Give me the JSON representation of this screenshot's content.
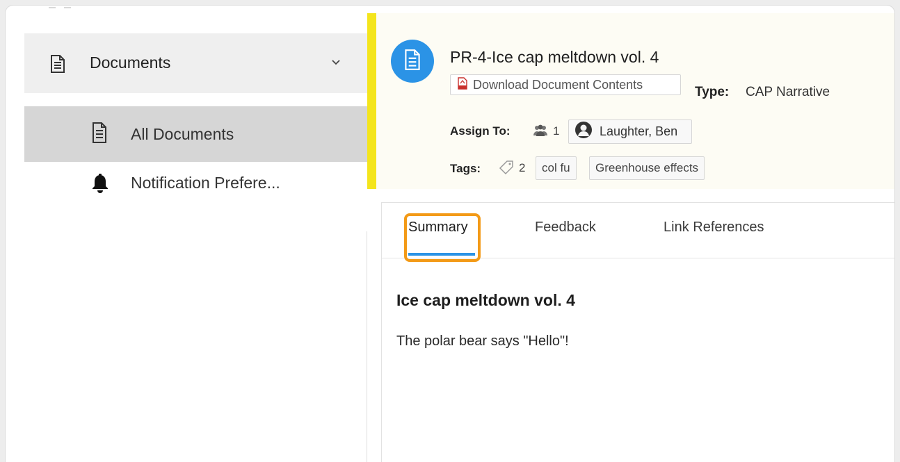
{
  "sidebar": {
    "group": {
      "label": "Documents",
      "icon": "document-icon",
      "expanded": true
    },
    "items": [
      {
        "label": "All Documents",
        "icon": "document-icon",
        "active": true
      },
      {
        "label": "Notification Prefere...",
        "icon": "bell-icon",
        "active": false
      }
    ]
  },
  "document": {
    "title": "PR-4-Ice cap meltdown vol. 4",
    "download_label": "Download Document Contents",
    "type_label": "Type:",
    "type_value": "CAP Narrative",
    "assign_label": "Assign To:",
    "assign_count": "1",
    "assignee": "Laughter, Ben",
    "tags_label": "Tags:",
    "tags_count": "2",
    "tags": [
      "col fu",
      "Greenhouse effects"
    ]
  },
  "tabs": [
    {
      "label": "Summary",
      "active": true
    },
    {
      "label": "Feedback",
      "active": false
    },
    {
      "label": "Link References",
      "active": false
    }
  ],
  "summary": {
    "title": "Ice cap meltdown vol. 4",
    "text": "The polar bear says \"Hello\"!"
  },
  "colors": {
    "accent_blue": "#2b93e6",
    "header_stripe": "#f4e51c",
    "highlight": "#f39a17"
  }
}
